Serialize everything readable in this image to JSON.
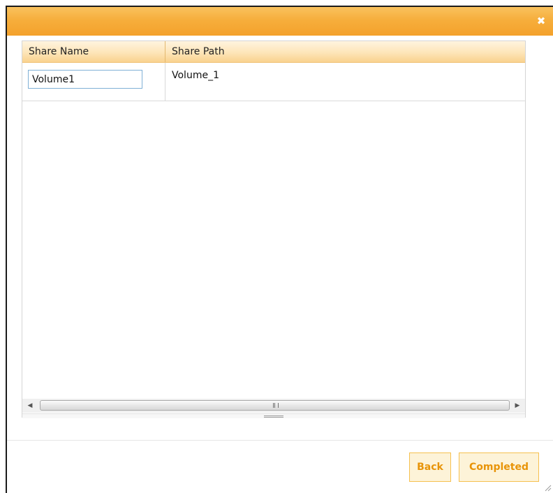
{
  "dialog": {
    "close_icon": "close-icon",
    "close_glyph": "✖"
  },
  "grid": {
    "columns": [
      "Share Name",
      "Share Path"
    ],
    "rows": [
      {
        "share_name": "Volume1",
        "share_path": "Volume_1"
      }
    ],
    "scroll_left_glyph": "◀",
    "scroll_right_glyph": "▶"
  },
  "buttons": {
    "back": "Back",
    "completed": "Completed"
  },
  "colors": {
    "titlebar": "#f6ae3c",
    "button_text": "#e89408",
    "button_border": "#f6c04f",
    "header_bg": "#fde5b8"
  }
}
